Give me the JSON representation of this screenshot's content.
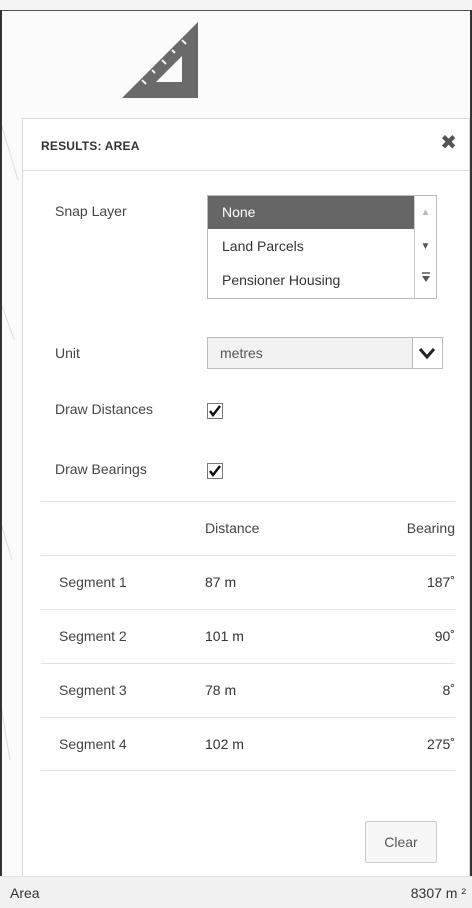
{
  "panel": {
    "title": "RESULTS: AREA",
    "close_symbol": "✖"
  },
  "snap_layer": {
    "label": "Snap Layer",
    "options": [
      "None",
      "Land Parcels",
      "Pensioner Housing"
    ],
    "selected": "None"
  },
  "unit": {
    "label": "Unit",
    "value": "metres"
  },
  "draw_distances": {
    "label": "Draw Distances",
    "checked": true
  },
  "draw_bearings": {
    "label": "Draw Bearings",
    "checked": true
  },
  "table": {
    "headers": {
      "segment": "",
      "distance": "Distance",
      "bearing": "Bearing"
    },
    "rows": [
      {
        "segment": "Segment 1",
        "distance": "87 m",
        "bearing": "187˚"
      },
      {
        "segment": "Segment 2",
        "distance": "101 m",
        "bearing": "90˚"
      },
      {
        "segment": "Segment 3",
        "distance": "78 m",
        "bearing": "8˚"
      },
      {
        "segment": "Segment 4",
        "distance": "102 m",
        "bearing": "275˚"
      }
    ]
  },
  "clear_button": "Clear",
  "footer": {
    "label": "Area",
    "value": "8307 m ²"
  },
  "icons": {
    "tool": "set-square-ruler-icon",
    "close": "close-icon",
    "dropdown": "chevron-down-icon",
    "check": "checkmark-icon"
  }
}
